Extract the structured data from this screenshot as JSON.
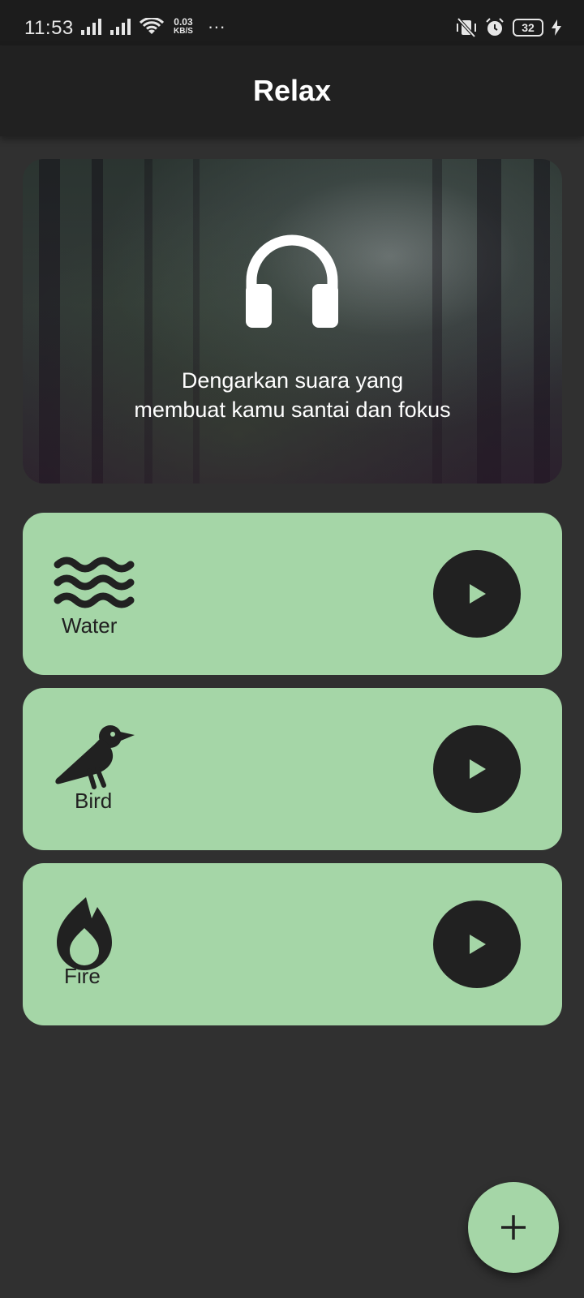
{
  "status_bar": {
    "time": "11:53",
    "net_speed_value": "0.03",
    "net_speed_unit": "KB/S",
    "more": "···",
    "battery_level": "32"
  },
  "app_bar": {
    "title": "Relax"
  },
  "hero": {
    "line1": "Dengarkan suara yang",
    "line2": "membuat kamu santai dan fokus",
    "icon": "headphones-icon"
  },
  "sounds": [
    {
      "label": "Water",
      "icon": "waves-icon",
      "action_icon": "play-icon"
    },
    {
      "label": "Bird",
      "icon": "bird-icon",
      "action_icon": "play-icon"
    },
    {
      "label": "Fire",
      "icon": "fire-icon",
      "action_icon": "play-icon"
    }
  ],
  "fab": {
    "icon": "add-icon"
  },
  "colors": {
    "background": "#303030",
    "app_bar": "#212121",
    "card": "#a5d6a7",
    "button": "#212121",
    "text_on_card": "#212121"
  }
}
